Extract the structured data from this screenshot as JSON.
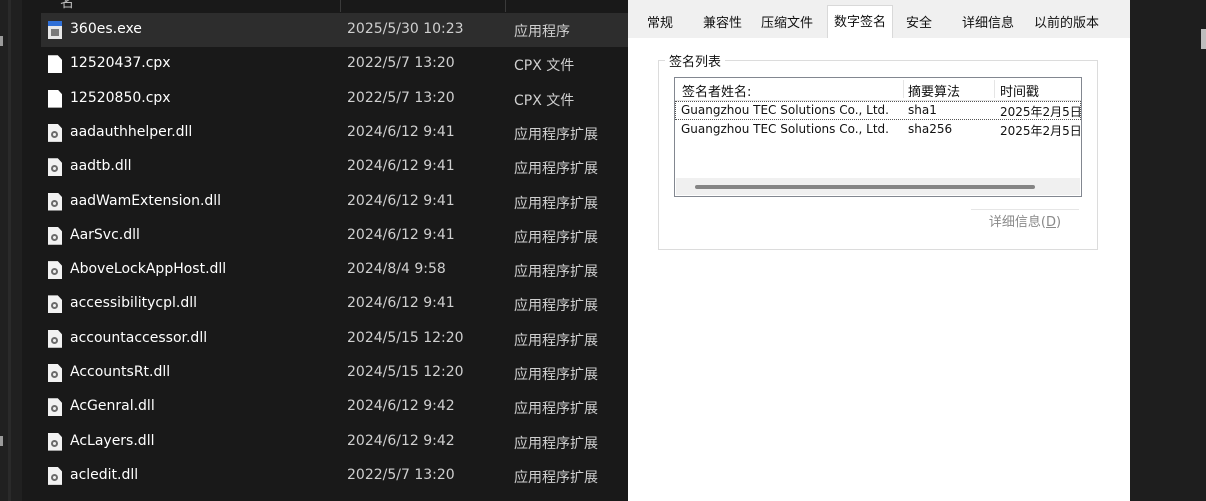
{
  "explorer": {
    "header_fragment": "名",
    "files": [
      {
        "name": "360es.exe",
        "date": "2025/5/30 10:23",
        "type": "应用程序",
        "icon": "exe-icon",
        "selected": true
      },
      {
        "name": "12520437.cpx",
        "date": "2022/5/7 13:20",
        "type": "CPX 文件",
        "icon": "file-icon"
      },
      {
        "name": "12520850.cpx",
        "date": "2022/5/7 13:20",
        "type": "CPX 文件",
        "icon": "file-icon"
      },
      {
        "name": "aadauthhelper.dll",
        "date": "2024/6/12 9:41",
        "type": "应用程序扩展",
        "icon": "dll-icon"
      },
      {
        "name": "aadtb.dll",
        "date": "2024/6/12 9:41",
        "type": "应用程序扩展",
        "icon": "dll-icon"
      },
      {
        "name": "aadWamExtension.dll",
        "date": "2024/6/12 9:41",
        "type": "应用程序扩展",
        "icon": "dll-icon"
      },
      {
        "name": "AarSvc.dll",
        "date": "2024/6/12 9:41",
        "type": "应用程序扩展",
        "icon": "dll-icon"
      },
      {
        "name": "AboveLockAppHost.dll",
        "date": "2024/8/4 9:58",
        "type": "应用程序扩展",
        "icon": "dll-icon"
      },
      {
        "name": "accessibilitycpl.dll",
        "date": "2024/6/12 9:41",
        "type": "应用程序扩展",
        "icon": "dll-icon"
      },
      {
        "name": "accountaccessor.dll",
        "date": "2024/5/15 12:20",
        "type": "应用程序扩展",
        "icon": "dll-icon"
      },
      {
        "name": "AccountsRt.dll",
        "date": "2024/5/15 12:20",
        "type": "应用程序扩展",
        "icon": "dll-icon"
      },
      {
        "name": "AcGenral.dll",
        "date": "2024/6/12 9:42",
        "type": "应用程序扩展",
        "icon": "dll-icon"
      },
      {
        "name": "AcLayers.dll",
        "date": "2024/6/12 9:42",
        "type": "应用程序扩展",
        "icon": "dll-icon"
      },
      {
        "name": "acledit.dll",
        "date": "2022/5/7 13:20",
        "type": "应用程序扩展",
        "icon": "dll-icon"
      }
    ]
  },
  "dialog": {
    "tabs": [
      {
        "label": "常规"
      },
      {
        "label": "兼容性"
      },
      {
        "label": "压缩文件"
      },
      {
        "label": "数字签名",
        "active": true
      },
      {
        "label": "安全"
      },
      {
        "label": "详细信息"
      },
      {
        "label": "以前的版本"
      }
    ],
    "signature_group_label": "签名列表",
    "columns": [
      "签名者姓名:",
      "摘要算法",
      "时间戳"
    ],
    "rows": [
      {
        "signer": "Guangzhou TEC Solutions Co., Ltd.",
        "algorithm": "sha1",
        "timestamp": "2025年2月5日"
      },
      {
        "signer": "Guangzhou TEC Solutions Co., Ltd.",
        "algorithm": "sha256",
        "timestamp": "2025年2月5日"
      }
    ],
    "details_button": {
      "label": "详细信息",
      "accel": "D"
    }
  }
}
